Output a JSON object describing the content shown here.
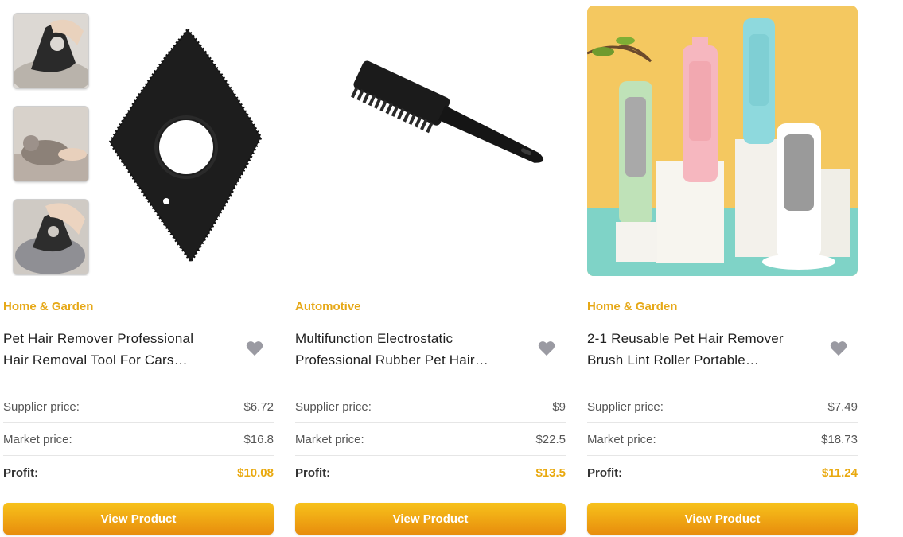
{
  "products": [
    {
      "category": "Home & Garden",
      "title": "Pet Hair Remover Professional Hair Removal Tool For Cars…",
      "supplier_label": "Supplier price:",
      "supplier_price": "$6.72",
      "market_label": "Market price:",
      "market_price": "$16.8",
      "profit_label": "Profit:",
      "profit": "$10.08",
      "button": "View Product",
      "favorite_icon": "heart-icon"
    },
    {
      "category": "Automotive",
      "title": "Multifunction Electrostatic Professional Rubber Pet Hair…",
      "supplier_label": "Supplier price:",
      "supplier_price": "$9",
      "market_label": "Market price:",
      "market_price": "$22.5",
      "profit_label": "Profit:",
      "profit": "$13.5",
      "button": "View Product",
      "favorite_icon": "heart-icon"
    },
    {
      "category": "Home & Garden",
      "title": "2-1 Reusable Pet Hair Remover Brush Lint Roller Portable…",
      "supplier_label": "Supplier price:",
      "supplier_price": "$7.49",
      "market_label": "Market price:",
      "market_price": "$18.73",
      "profit_label": "Profit:",
      "profit": "$11.24",
      "button": "View Product",
      "favorite_icon": "heart-icon"
    }
  ],
  "colors": {
    "accent": "#e6a817",
    "profit": "#e9a90f",
    "button_top": "#f7c21b",
    "button_bottom": "#e88d0d",
    "heart": "#9a9aa2"
  }
}
